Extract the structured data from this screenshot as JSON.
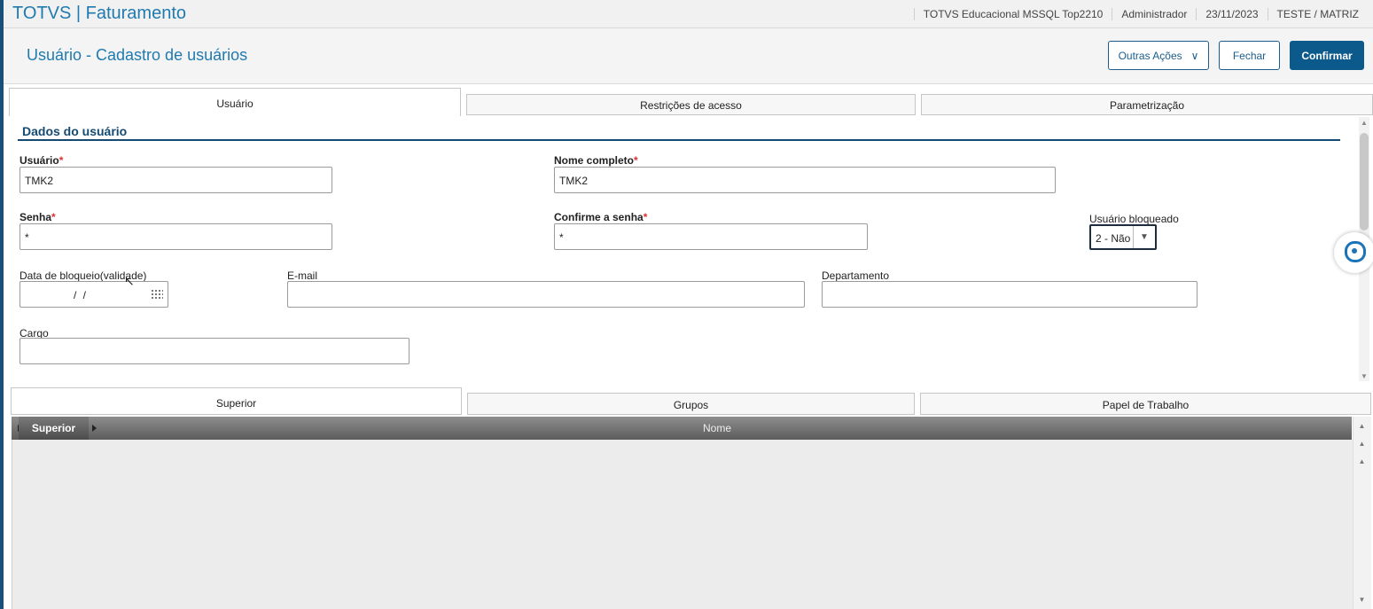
{
  "app": {
    "title": "TOTVS | Faturamento"
  },
  "topbar": {
    "environment": "TOTVS Educacional MSSQL Top2210",
    "user": "Administrador",
    "date": "23/11/2023",
    "company": "TESTE / MATRIZ"
  },
  "header": {
    "page_title": "Usuário - Cadastro de usuários",
    "other_actions": "Outras Ações",
    "close": "Fechar",
    "confirm": "Confirmar"
  },
  "tabs": [
    {
      "label": "Usuário"
    },
    {
      "label": "Restrições de acesso"
    },
    {
      "label": "Parametrização"
    }
  ],
  "section": {
    "title": "Dados do usuário"
  },
  "form": {
    "usuario": {
      "label": "Usuário",
      "value": "TMK2"
    },
    "nome_completo": {
      "label": "Nome completo",
      "value": "TMK2"
    },
    "senha": {
      "label": "Senha",
      "value": "*"
    },
    "confirme_senha": {
      "label": "Confirme a senha",
      "value": "*"
    },
    "usuario_bloqueado": {
      "label": "Usuário bloqueado",
      "value": "2 - Não"
    },
    "data_bloqueio": {
      "label": "Data de bloqueio(validade)",
      "value": "/ /"
    },
    "email": {
      "label": "E-mail",
      "value": ""
    },
    "departamento": {
      "label": "Departamento",
      "value": ""
    },
    "cargo": {
      "label": "Cargo",
      "value": ""
    }
  },
  "subtabs": [
    {
      "label": "Superior"
    },
    {
      "label": "Grupos"
    },
    {
      "label": "Papel de Trabalho"
    }
  ],
  "grid": {
    "columns": [
      "Superior",
      "Nome"
    ],
    "rows": []
  },
  "colors": {
    "accent": "#1f7ab0",
    "primary_button": "#0c5a8c",
    "section": "#154a72",
    "required": "#e03030"
  }
}
